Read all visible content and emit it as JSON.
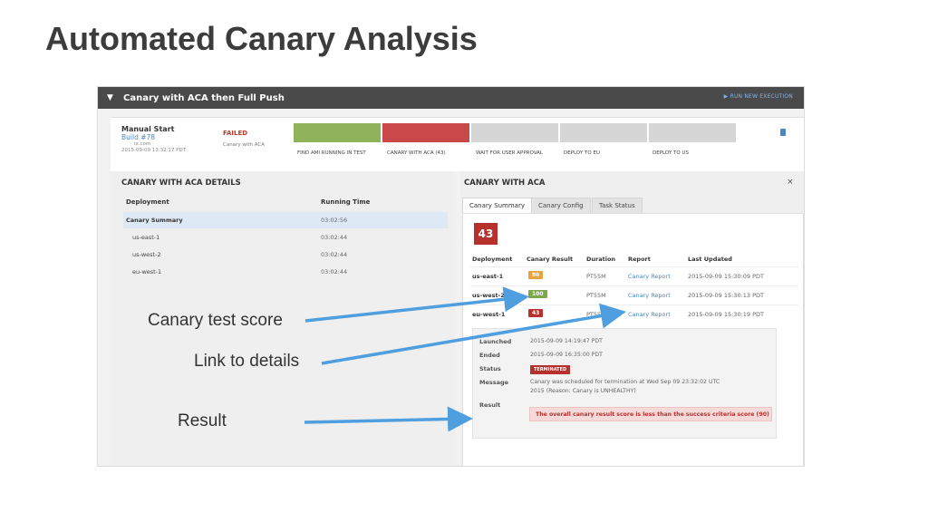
{
  "slide": {
    "title": "Automated Canary Analysis"
  },
  "pipeline": {
    "name": "Canary with ACA then Full Push",
    "run_new": "▶ RUN NEW EXECUTION"
  },
  "execution": {
    "trigger": "Manual Start",
    "build": "Build #78",
    "user": "ix.com",
    "time": "2015-09-09 13:32:17 PDT",
    "status": "FAILED",
    "status_sub": "Canary with ACA",
    "stages": [
      {
        "label": "FIND AMI RUNNING IN TEST",
        "color": "#8fb35a"
      },
      {
        "label": "CANARY WITH ACA (43)",
        "color": "#c9484a"
      },
      {
        "label": "WAIT FOR USER APPROVAL",
        "color": "#d6d6d6"
      },
      {
        "label": "DEPLOY TO EU",
        "color": "#d6d6d6"
      },
      {
        "label": "DEPLOY TO US",
        "color": "#d6d6d6"
      }
    ]
  },
  "details": {
    "title": "CANARY WITH ACA DETAILS",
    "col_deployment": "Deployment",
    "col_running": "Running Time",
    "rows": [
      {
        "name": "Canary Summary",
        "time": "03:02:56"
      },
      {
        "name": "us-east-1",
        "time": "03:02:44"
      },
      {
        "name": "us-west-2",
        "time": "03:02:44"
      },
      {
        "name": "eu-west-1",
        "time": "03:02:44"
      }
    ]
  },
  "canary": {
    "title": "CANARY WITH ACA",
    "close": "×",
    "tabs": [
      "Canary Summary",
      "Canary Config",
      "Task Status"
    ],
    "score": "43",
    "headers": {
      "deployment": "Deployment",
      "result": "Canary Result",
      "duration": "Duration",
      "report": "Report",
      "updated": "Last Updated"
    },
    "rows": [
      {
        "deployment": "us-east-1",
        "score": "86",
        "color": "#e8a23c",
        "duration": "PT55M",
        "report": "Canary Report",
        "updated": "2015-09-09 15:30:09 PDT"
      },
      {
        "deployment": "us-west-2",
        "score": "100",
        "color": "#7aa84a",
        "duration": "PT55M",
        "report": "Canary Report",
        "updated": "2015-09-09 15:30:13 PDT"
      },
      {
        "deployment": "eu-west-1",
        "score": "43",
        "color": "#b7312c",
        "duration": "PT55M",
        "report": "Canary Report",
        "updated": "2015-09-09 15:30:19 PDT"
      }
    ],
    "info": {
      "launched_label": "Launched",
      "launched": "2015-09-09 14:19:47 PDT",
      "ended_label": "Ended",
      "ended": "2015-09-09 16:35:00 PDT",
      "status_label": "Status",
      "status": "TERMINATED",
      "message_label": "Message",
      "message_1": "Canary was scheduled for termination at Wed Sep 09 23:32:02 UTC",
      "message_2": "2015 (Reason: Canary is UNHEALTHY)",
      "result_label": "Result",
      "result": "The overall canary result score is less than the success criteria score (90)"
    }
  },
  "callouts": {
    "score": "Canary test score",
    "link": "Link to details",
    "result": "Result"
  },
  "colors": {
    "arrow": "#4f9fe0",
    "failed": "#c0392b",
    "link": "#4a86c5"
  }
}
